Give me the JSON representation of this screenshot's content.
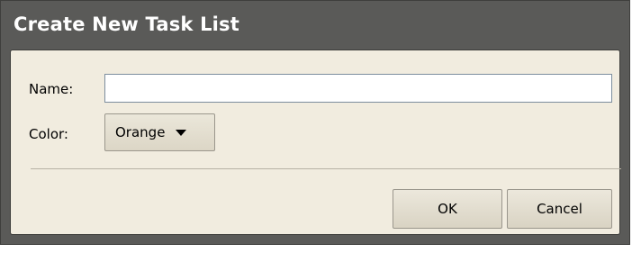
{
  "dialog": {
    "title": "Create New Task List",
    "name_label": "Name:",
    "name_value": "",
    "color_label": "Color:",
    "color_selected": "Orange",
    "ok_label": "OK",
    "cancel_label": "Cancel"
  },
  "colors": {
    "titlebar_bg": "#5a5a58",
    "content_bg": "#f1ecdf",
    "title_text": "#ffffff"
  }
}
